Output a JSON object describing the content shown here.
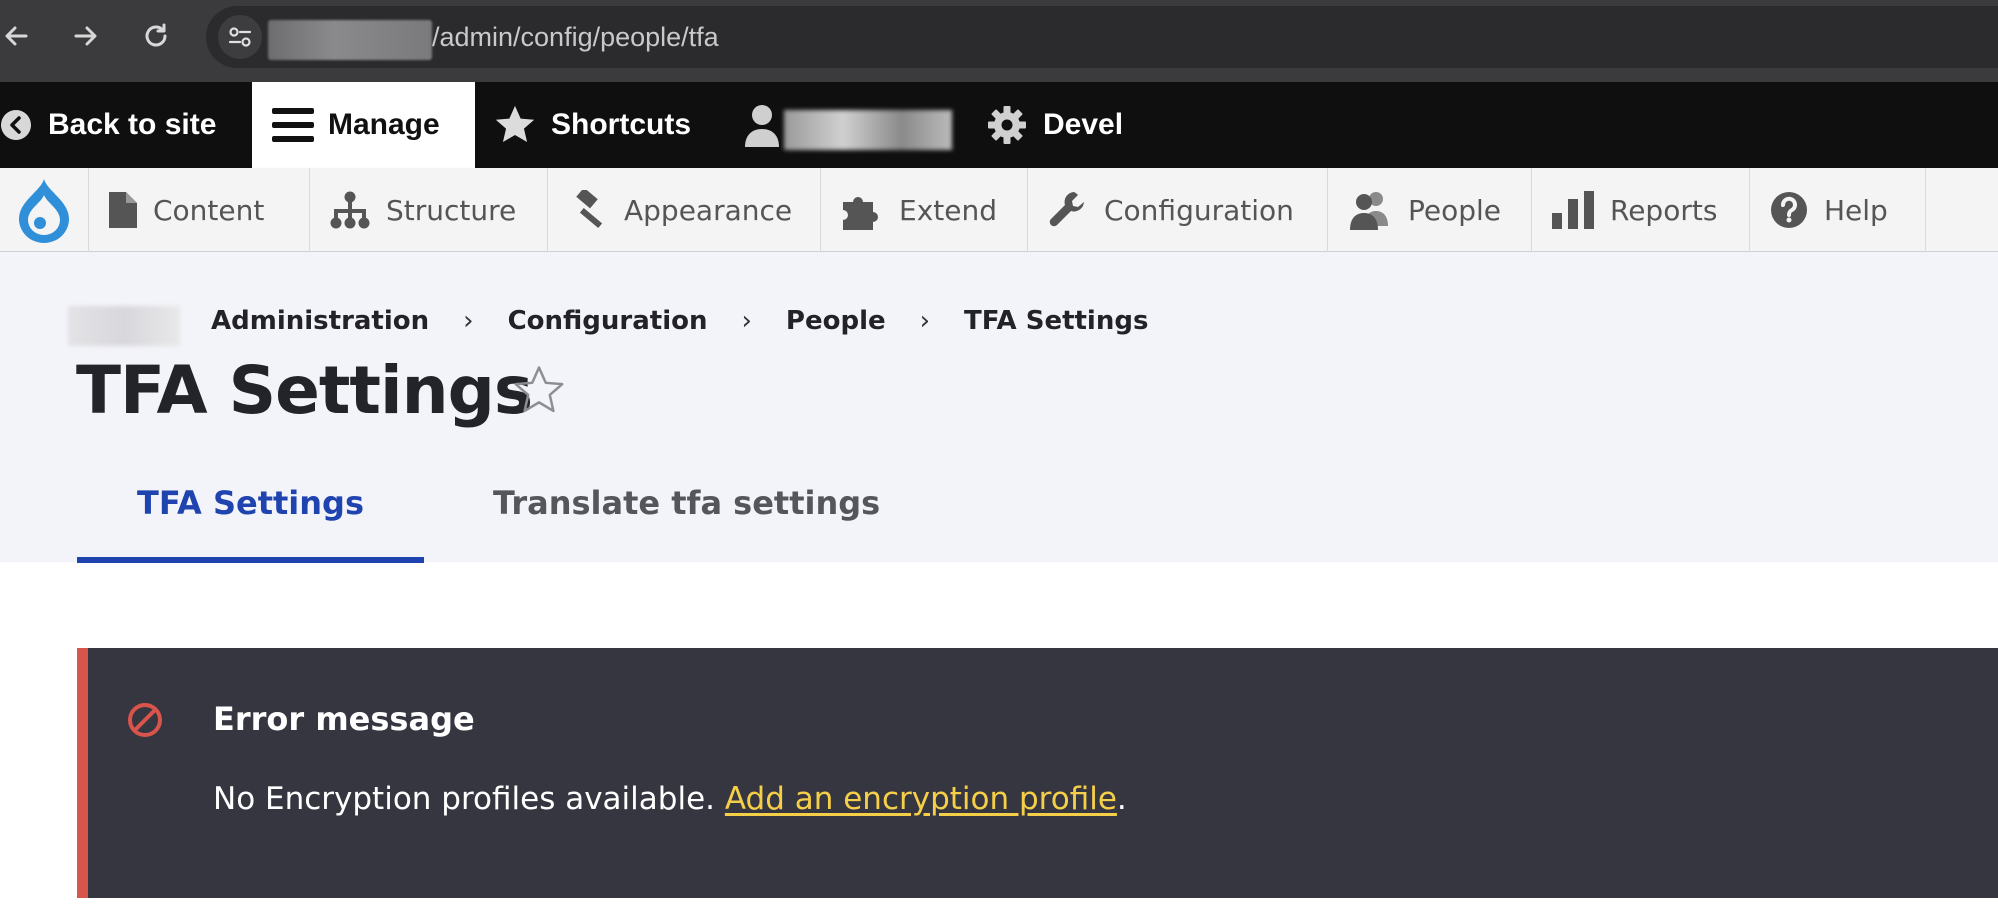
{
  "browser": {
    "url_path": "/admin/config/people/tfa"
  },
  "toolbar": {
    "back_to_site": "Back to site",
    "manage": "Manage",
    "shortcuts": "Shortcuts",
    "devel": "Devel"
  },
  "tray": {
    "items": [
      {
        "label": "Content",
        "icon": "file-icon"
      },
      {
        "label": "Structure",
        "icon": "structure-icon"
      },
      {
        "label": "Appearance",
        "icon": "paintbrush-icon"
      },
      {
        "label": "Extend",
        "icon": "puzzle-icon"
      },
      {
        "label": "Configuration",
        "icon": "wrench-icon"
      },
      {
        "label": "People",
        "icon": "people-icon"
      },
      {
        "label": "Reports",
        "icon": "bar-chart-icon"
      },
      {
        "label": "Help",
        "icon": "help-icon"
      }
    ]
  },
  "breadcrumb": {
    "items": [
      "Administration",
      "Configuration",
      "People",
      "TFA Settings"
    ],
    "separator": "›"
  },
  "page": {
    "title": "TFA Settings"
  },
  "tabs": [
    {
      "label": "TFA Settings",
      "active": true
    },
    {
      "label": "Translate tfa settings",
      "active": false
    }
  ],
  "message": {
    "title": "Error message",
    "text": "No Encryption profiles available. ",
    "link": "Add an encryption profile",
    "suffix": "."
  },
  "colors": {
    "accent_blue": "#1f44b0",
    "error_red": "#d9544a",
    "link_yellow": "#f6cf49",
    "message_bg": "#363641",
    "drupal_blue": "#2f8fd8"
  }
}
